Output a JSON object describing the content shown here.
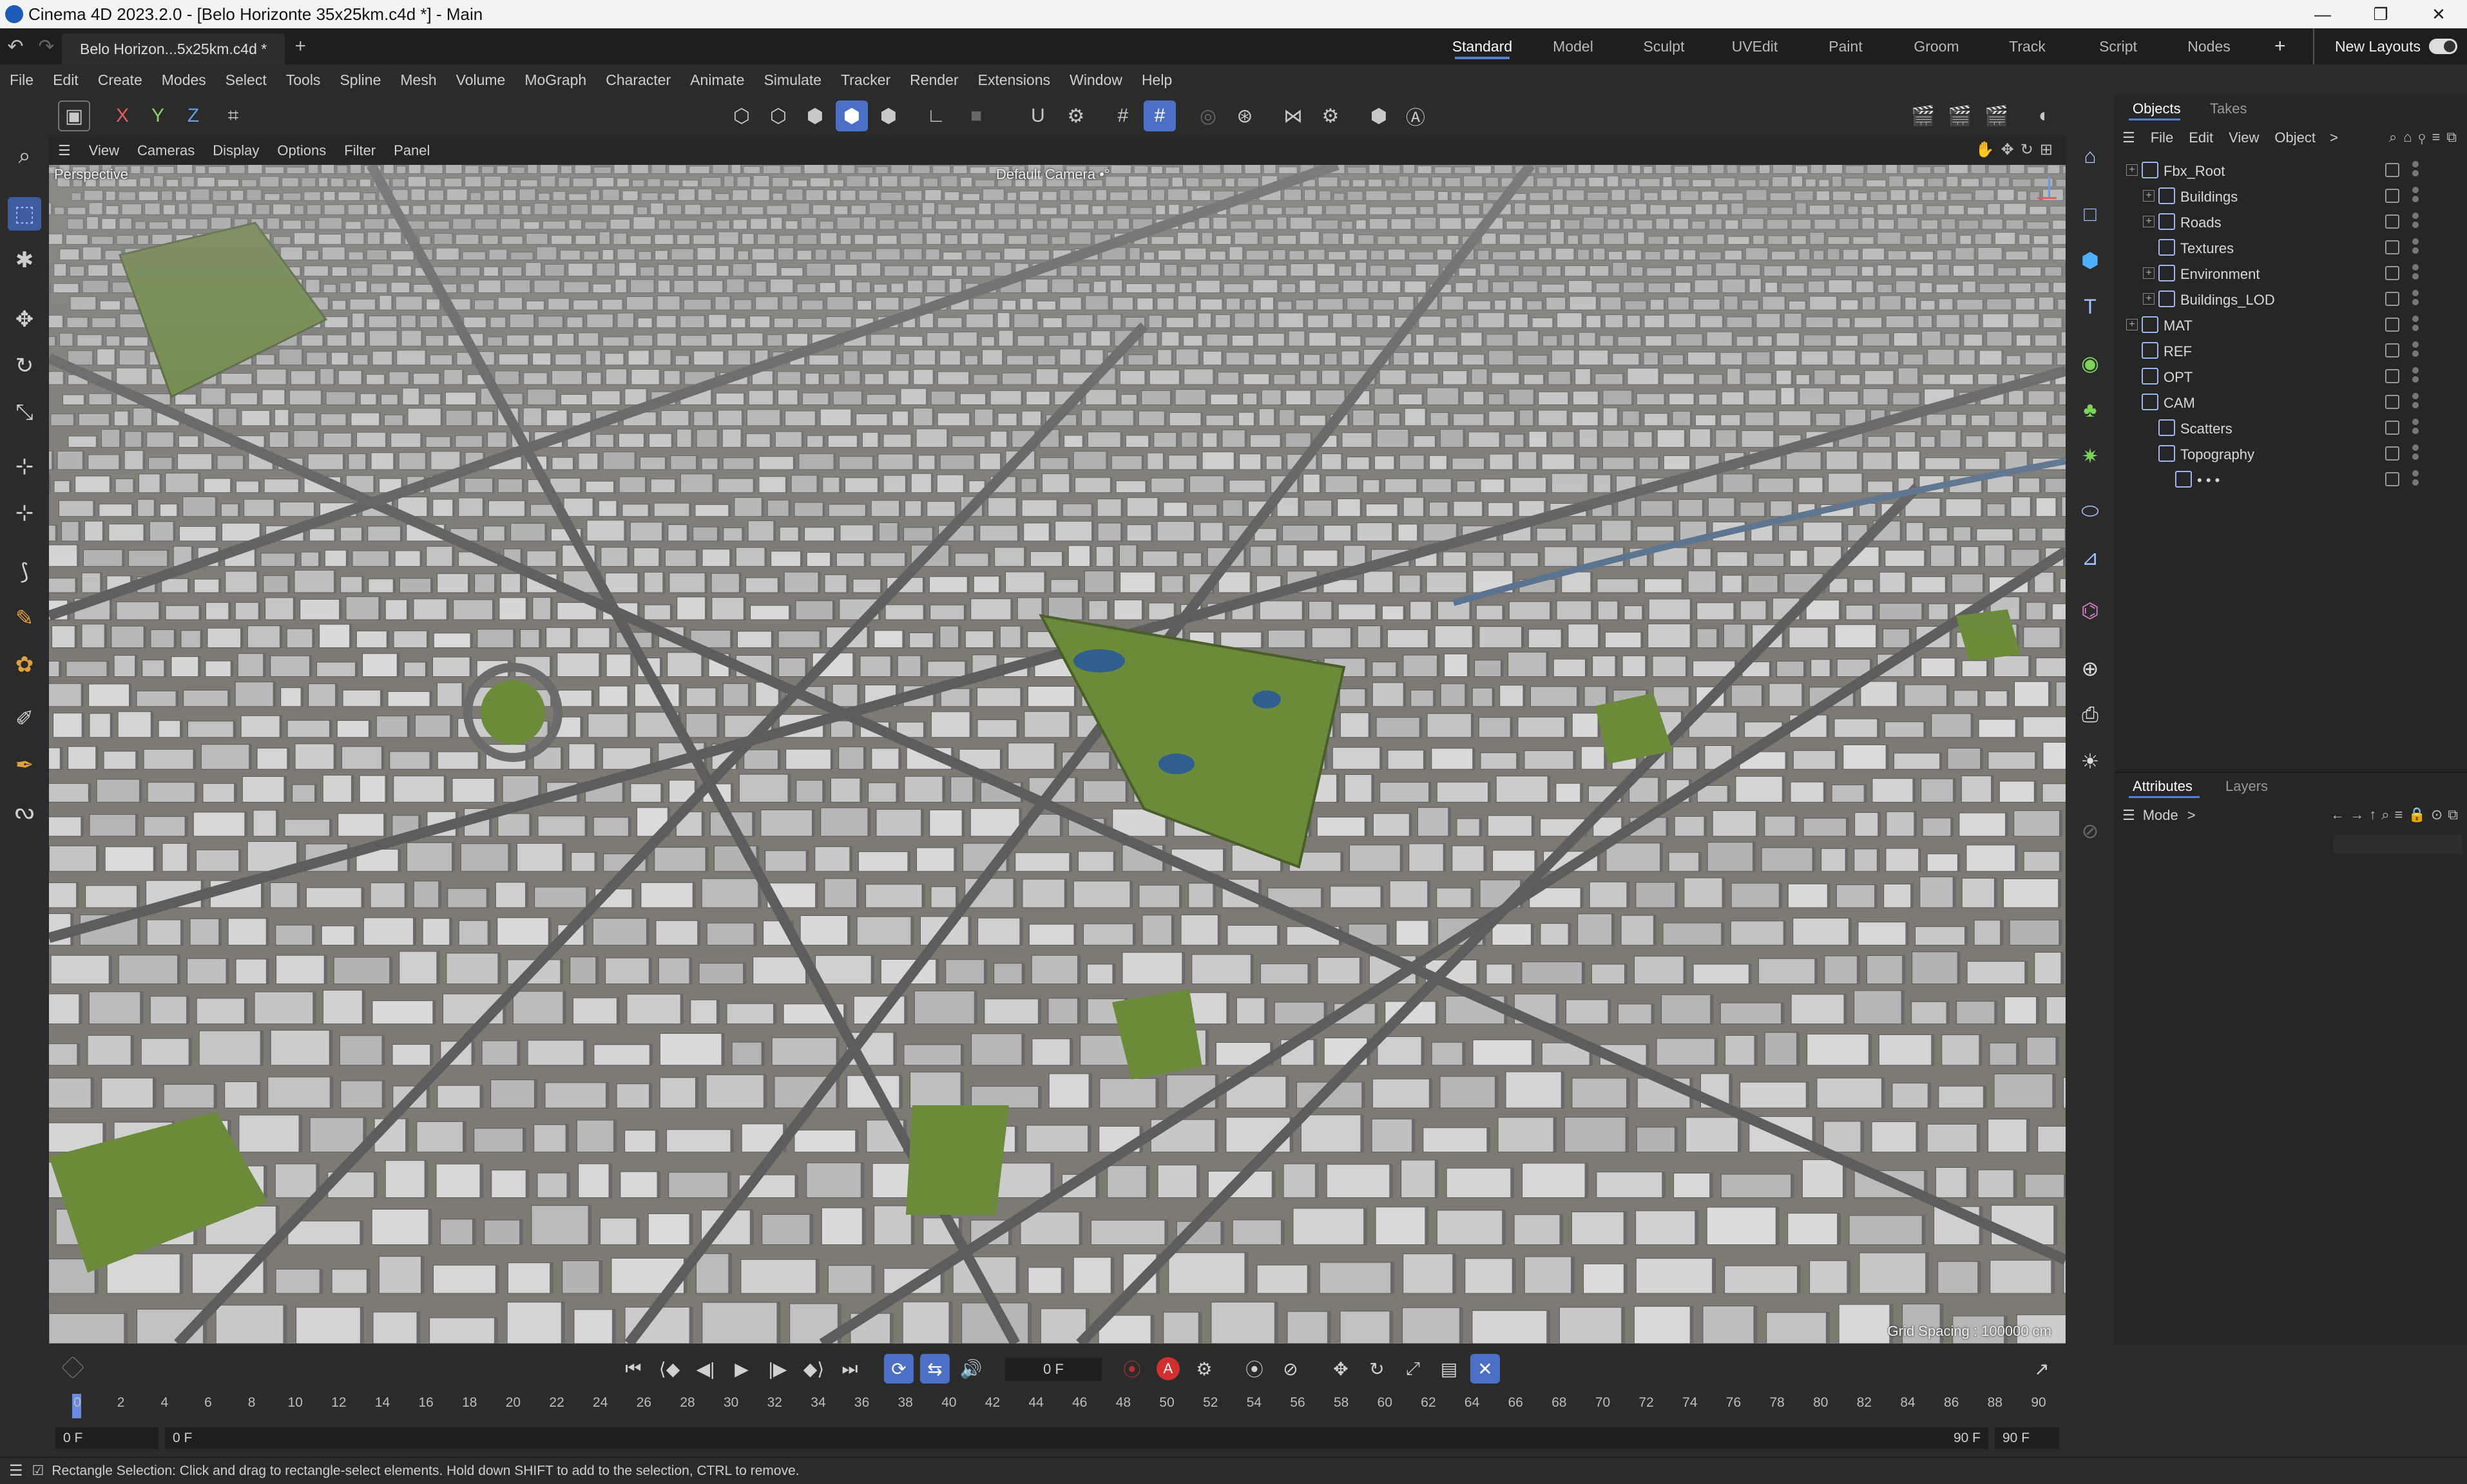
{
  "window": {
    "title": "Cinema 4D 2023.2.0 - [Belo Horizonte 35x25km.c4d *] - Main",
    "minimize": "—",
    "maximize": "❐",
    "close": "✕"
  },
  "tabs": {
    "document_tab": "Belo Horizon...5x25km.c4d *",
    "add_tab": "+",
    "layouts": [
      "Standard",
      "Model",
      "Sculpt",
      "UVEdit",
      "Paint",
      "Groom",
      "Track",
      "Script",
      "Nodes"
    ],
    "active_layout": "Standard",
    "add_layout": "+",
    "new_layouts": "New Layouts"
  },
  "menus": [
    "File",
    "Edit",
    "Create",
    "Modes",
    "Select",
    "Tools",
    "Spline",
    "Mesh",
    "Volume",
    "MoGraph",
    "Character",
    "Animate",
    "Simulate",
    "Tracker",
    "Render",
    "Extensions",
    "Window",
    "Help"
  ],
  "toolbar": {
    "axis_x": "X",
    "axis_y": "Y",
    "axis_z": "Z"
  },
  "viewport": {
    "menus": [
      "View",
      "Cameras",
      "Display",
      "Options",
      "Filter",
      "Panel"
    ],
    "projection": "Perspective",
    "camera": "Default Camera",
    "camera_suffix": "•°",
    "grid_spacing": "Grid Spacing : 100000 cm"
  },
  "objects_panel": {
    "tabs": [
      "Objects",
      "Takes"
    ],
    "active_tab": "Objects",
    "menus": [
      "File",
      "Edit",
      "View",
      "Object"
    ],
    "more": ">",
    "items": [
      {
        "name": "Fbx_Root",
        "depth": 0,
        "expandable": true
      },
      {
        "name": "Buildings",
        "depth": 1,
        "expandable": true
      },
      {
        "name": "Roads",
        "depth": 1,
        "expandable": true
      },
      {
        "name": "Textures",
        "depth": 1,
        "expandable": false
      },
      {
        "name": "Environment",
        "depth": 1,
        "expandable": true
      },
      {
        "name": "Buildings_LOD",
        "depth": 1,
        "expandable": true
      },
      {
        "name": "MAT",
        "depth": 0,
        "expandable": true
      },
      {
        "name": "REF",
        "depth": 0,
        "expandable": false
      },
      {
        "name": "OPT",
        "depth": 0,
        "expandable": false
      },
      {
        "name": "CAM",
        "depth": 0,
        "expandable": false
      },
      {
        "name": "Scatters",
        "depth": 1,
        "expandable": false
      },
      {
        "name": "Topography",
        "depth": 1,
        "expandable": false
      },
      {
        "name": "• • •",
        "depth": 2,
        "expandable": false
      }
    ]
  },
  "attributes_panel": {
    "tabs": [
      "Attributes",
      "Layers"
    ],
    "active_tab": "Attributes",
    "mode_label": "Mode",
    "more": ">"
  },
  "timeline": {
    "current_frame": "0 F",
    "ticks": [
      "0",
      "2",
      "4",
      "6",
      "8",
      "10",
      "12",
      "14",
      "16",
      "18",
      "20",
      "22",
      "24",
      "26",
      "28",
      "30",
      "32",
      "34",
      "36",
      "38",
      "40",
      "42",
      "44",
      "46",
      "48",
      "50",
      "52",
      "54",
      "56",
      "58",
      "60",
      "62",
      "64",
      "66",
      "68",
      "70",
      "72",
      "74",
      "76",
      "78",
      "80",
      "82",
      "84",
      "86",
      "88",
      "90"
    ],
    "range_start": "0 F",
    "range_start2": "0 F",
    "range_end": "90 F",
    "range_end2": "90 F",
    "record_label": "A"
  },
  "status": {
    "message": "Rectangle Selection: Click and drag to rectangle-select elements. Hold down SHIFT to add to the selection, CTRL to remove."
  },
  "colors": {
    "accent": "#4b6fc4",
    "park_green": "#6b8a3a",
    "water_blue": "#2f5f8e",
    "city_gray": "#9a9a9a"
  },
  "icons": [
    "undo-icon",
    "redo-icon",
    "search-icon",
    "selection-icon",
    "move-icon",
    "rotate-icon",
    "scale-icon",
    "cube-icon",
    "text-icon",
    "camera-icon",
    "light-icon",
    "play-icon",
    "record-icon",
    "hamburger-menu-icon",
    "home-icon",
    "filter-icon",
    "lock-icon"
  ]
}
